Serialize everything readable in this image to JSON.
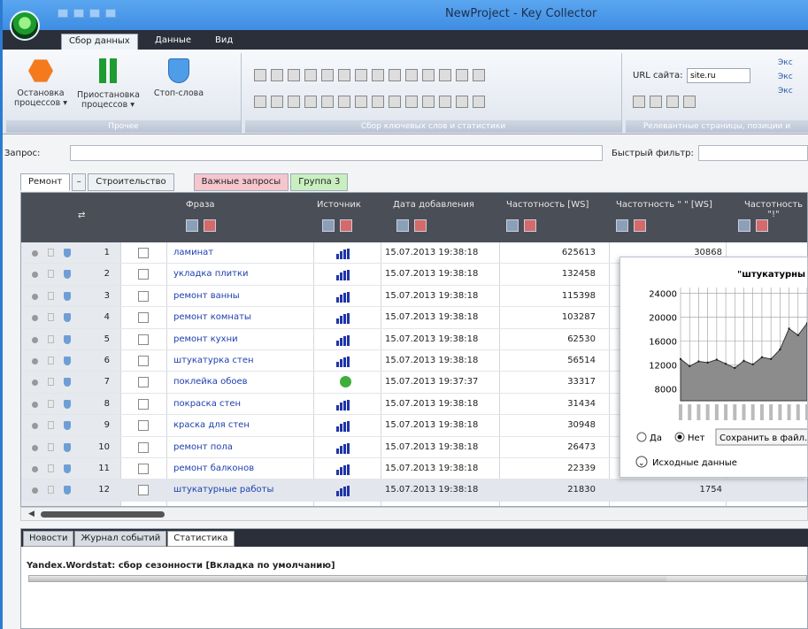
{
  "window": {
    "title": "NewProject - Key Collector"
  },
  "ribbon_tabs": [
    "Сбор данных",
    "Данные",
    "Вид"
  ],
  "ribbon": {
    "stop_label": "Остановка процессов ▾",
    "pause_label": "Приостановка процессов ▾",
    "stopwords_label": "Стоп-слова",
    "group_other": "Прочее",
    "group_keywords": "Сбор ключевых слов и статистики",
    "group_relevant": "Релевантные страницы, позиции и",
    "url_label": "URL сайта:",
    "url_value": "site.ru",
    "export1": "Экс",
    "export2": "Экс",
    "export3": "Экс"
  },
  "query": {
    "label": "Запрос:",
    "filter_label": "Быстрый фильтр:"
  },
  "group_tabs": [
    "Ремонт",
    "Строительство",
    "Важные запросы",
    "Группа 3"
  ],
  "columns": {
    "phrase": "Фраза",
    "source": "Источник",
    "date": "Дата добавления",
    "ws": "Частотность [WS]",
    "ws_quote": "Частотность \" \" [WS]",
    "ws_excl": "Частотность \"!\""
  },
  "rows": [
    {
      "n": "1",
      "phrase": "ламинат",
      "src": "bars",
      "date": "15.07.2013 19:38:18",
      "ws": "625613",
      "ws2": "30868"
    },
    {
      "n": "2",
      "phrase": "укладка плитки",
      "src": "bars",
      "date": "15.07.2013 19:38:18",
      "ws": "132458",
      "ws2": ""
    },
    {
      "n": "3",
      "phrase": "ремонт ванны",
      "src": "bars",
      "date": "15.07.2013 19:38:18",
      "ws": "115398",
      "ws2": ""
    },
    {
      "n": "4",
      "phrase": "ремонт комнаты",
      "src": "bars",
      "date": "15.07.2013 19:38:18",
      "ws": "103287",
      "ws2": ""
    },
    {
      "n": "5",
      "phrase": "ремонт кухни",
      "src": "bars",
      "date": "15.07.2013 19:38:18",
      "ws": "62530",
      "ws2": ""
    },
    {
      "n": "6",
      "phrase": "штукатурка стен",
      "src": "bars",
      "date": "15.07.2013 19:38:18",
      "ws": "56514",
      "ws2": ""
    },
    {
      "n": "7",
      "phrase": "поклейка обоев",
      "src": "plus",
      "date": "15.07.2013 19:37:37",
      "ws": "33317",
      "ws2": ""
    },
    {
      "n": "8",
      "phrase": "покраска стен",
      "src": "bars",
      "date": "15.07.2013 19:38:18",
      "ws": "31434",
      "ws2": ""
    },
    {
      "n": "9",
      "phrase": "краска для стен",
      "src": "bars",
      "date": "15.07.2013 19:38:18",
      "ws": "30948",
      "ws2": ""
    },
    {
      "n": "10",
      "phrase": "ремонт пола",
      "src": "bars",
      "date": "15.07.2013 19:38:18",
      "ws": "26473",
      "ws2": ""
    },
    {
      "n": "11",
      "phrase": "ремонт балконов",
      "src": "bars",
      "date": "15.07.2013 19:38:18",
      "ws": "22339",
      "ws2": ""
    },
    {
      "n": "12",
      "phrase": "штукатурные работы",
      "src": "bars",
      "date": "15.07.2013 19:38:18",
      "ws": "21830",
      "ws2": "1754"
    }
  ],
  "popup": {
    "title": "\"штукатурны",
    "yes": "Да",
    "no": "Нет",
    "save": "Сохранить в файл...",
    "source_data": "Исходные данные",
    "yticks": [
      "24000",
      "20000",
      "16000",
      "12000",
      "8000"
    ],
    "values": [
      13000,
      11800,
      12600,
      12400,
      12900,
      12200,
      11500,
      12700,
      12100,
      13300,
      13000,
      14600,
      18100,
      17000,
      19000
    ]
  },
  "bottom_tabs": [
    "Новости",
    "Журнал событий",
    "Статистика"
  ],
  "bottom": {
    "line": "Yandex.Wordstat: сбор сезонности [Вкладка по умолчанию]",
    "progress": 0.82
  },
  "colors": {
    "accent": "#3f8de3",
    "dark": "#4a4e57",
    "link": "#1d3fae"
  }
}
